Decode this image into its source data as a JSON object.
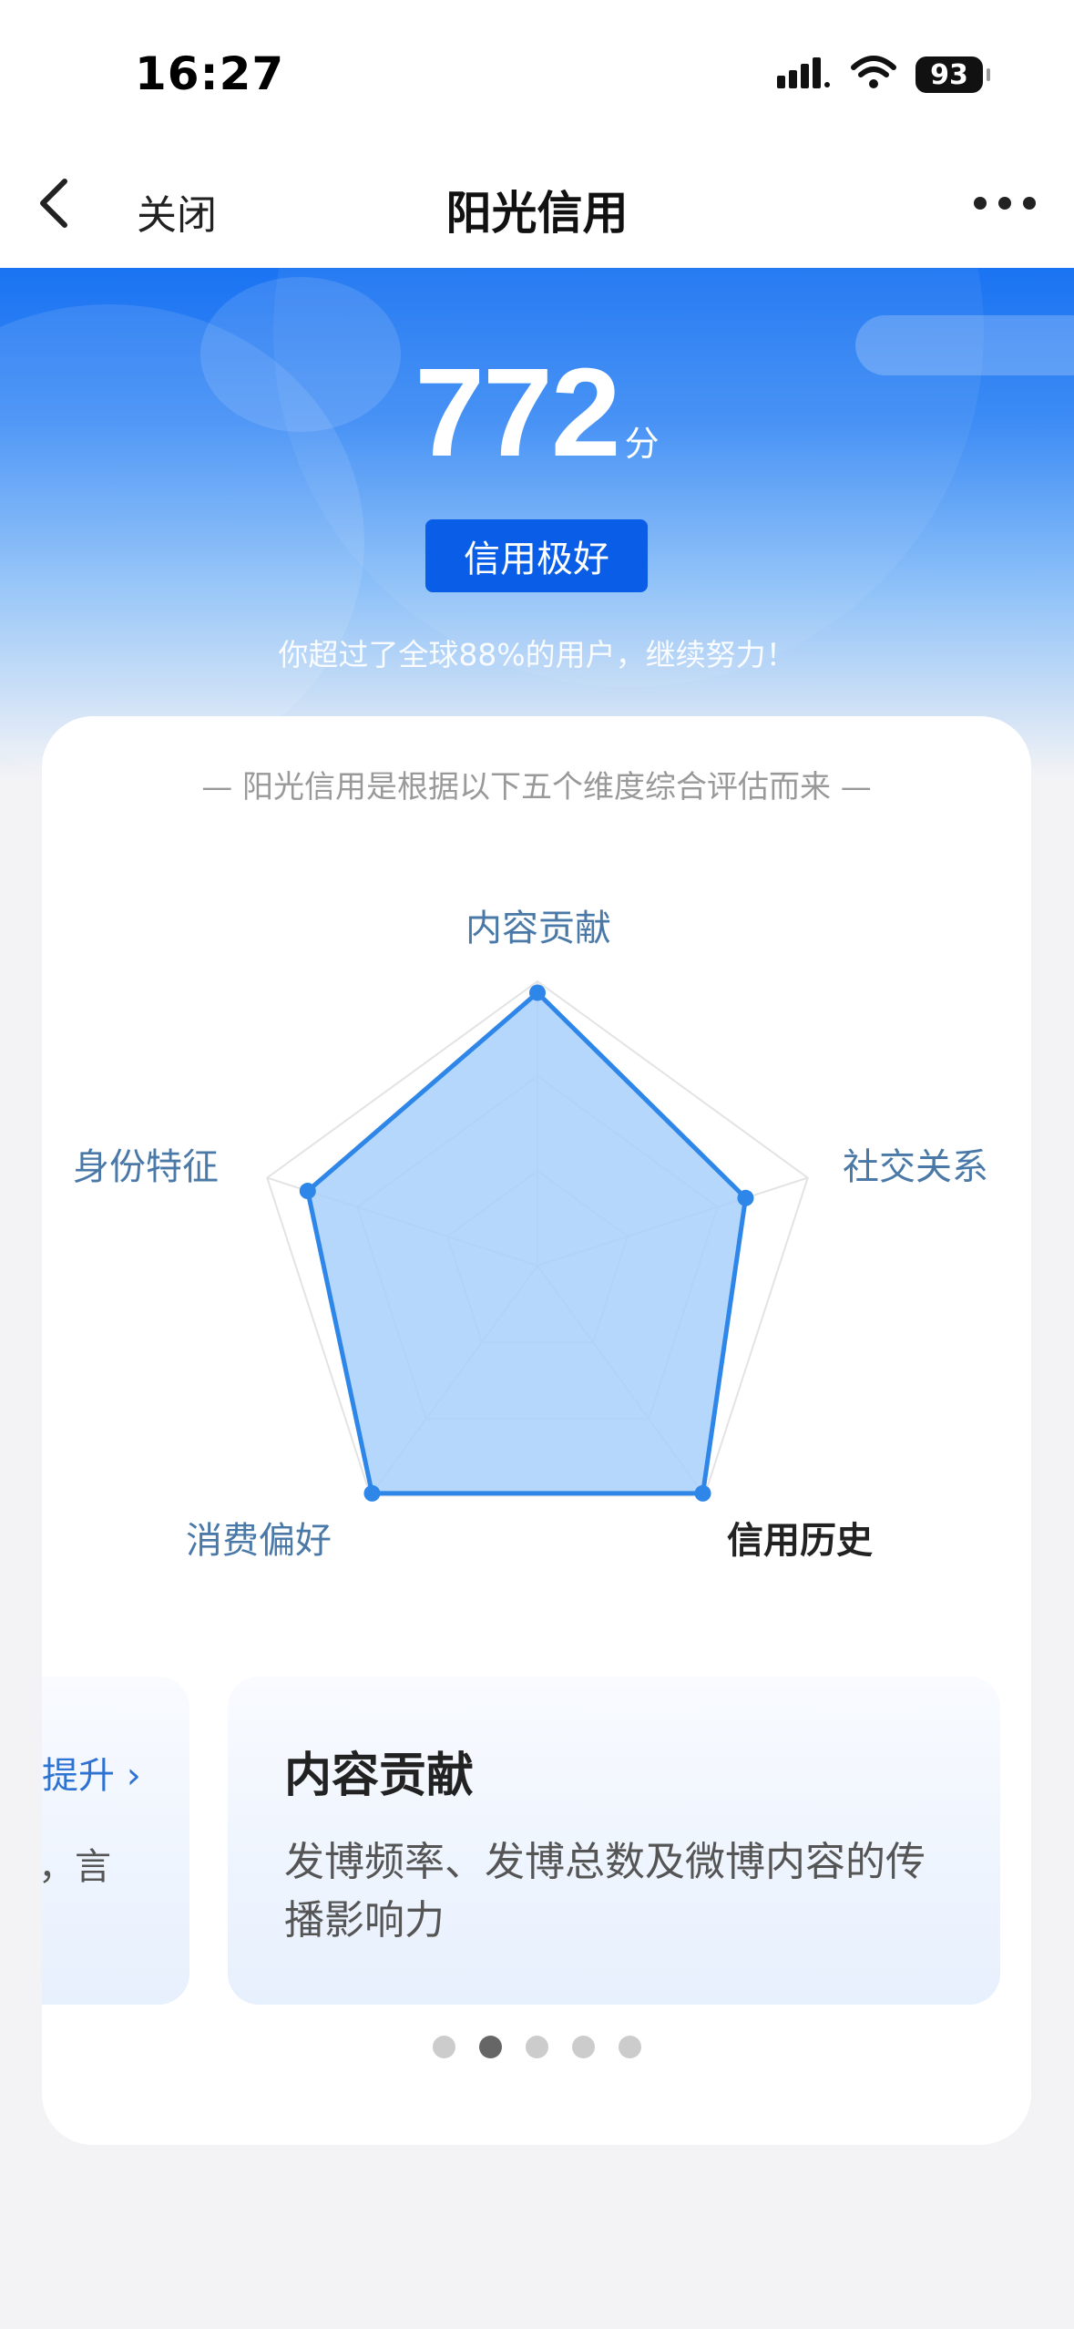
{
  "status_bar": {
    "time": "16:27",
    "battery": "93"
  },
  "nav": {
    "close_label": "关闭",
    "title": "阳光信用"
  },
  "score": {
    "value": "772",
    "unit": "分",
    "level": "信用极好",
    "rank_text": "你超过了全球88%的用户，继续努力！"
  },
  "radar": {
    "subtitle": "— 阳光信用是根据以下五个维度综合评估而来 —",
    "dimensions": [
      {
        "label": "内容贡献",
        "value": 0.96
      },
      {
        "label": "社交关系",
        "value": 0.77
      },
      {
        "label": "信用历史",
        "value": 0.99
      },
      {
        "label": "消费偏好",
        "value": 0.99
      },
      {
        "label": "身份特征",
        "value": 0.85
      }
    ],
    "active_label": "信用历史",
    "fill_color": "#a8d0fb",
    "stroke_color": "#2d86e8"
  },
  "carousel": {
    "prev": {
      "link": "提升 ›",
      "fragment": "，言"
    },
    "current": {
      "title": "内容贡献",
      "desc": "发博频率、发博总数及微博内容的传播影响力"
    },
    "dots": 5,
    "active_index": 1
  },
  "icons": {
    "back": "chevron-left-icon",
    "more": "more-dots-icon",
    "signal": "cellular-signal-icon",
    "wifi": "wifi-icon",
    "battery": "battery-icon"
  }
}
